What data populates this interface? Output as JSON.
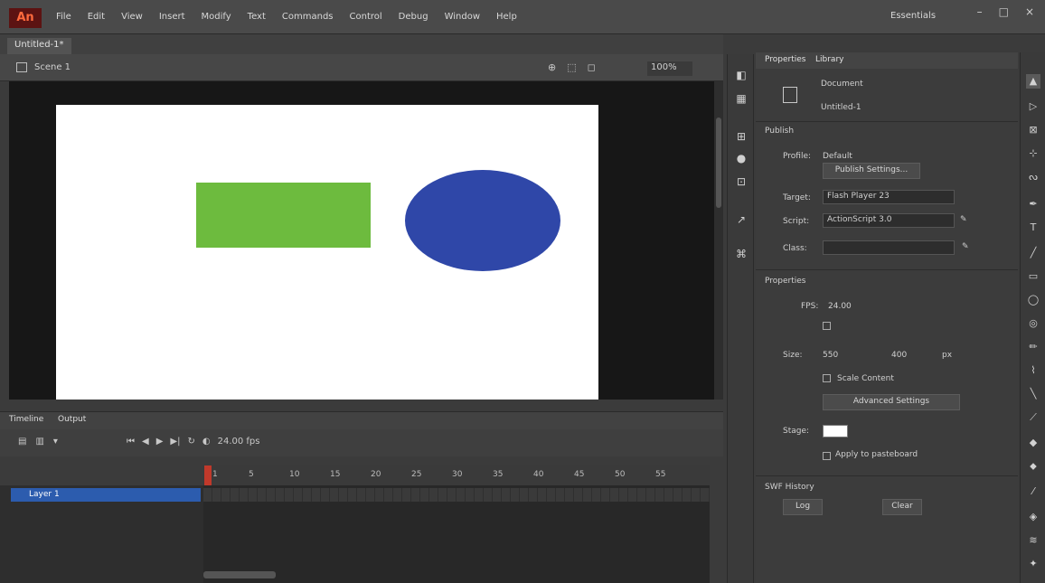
{
  "app": {
    "logo": "An"
  },
  "menu": [
    "File",
    "Edit",
    "View",
    "Insert",
    "Modify",
    "Text",
    "Commands",
    "Control",
    "Debug",
    "Window",
    "Help"
  ],
  "workspace": "Essentials",
  "window_controls": [
    "–",
    "□",
    "×"
  ],
  "document": {
    "tab": "Untitled-1*",
    "scene": "Scene 1",
    "zoom": "100%"
  },
  "stage": {
    "background": "#ffffff",
    "shapes": [
      {
        "kind": "rectangle",
        "fill": "#6dbb3e"
      },
      {
        "kind": "ellipse",
        "fill": "#2f47a8"
      }
    ]
  },
  "timeline": {
    "tabs": [
      "Timeline",
      "Output"
    ],
    "frame_numbers": [
      "1",
      "5",
      "10",
      "15",
      "20",
      "25",
      "30",
      "35",
      "40",
      "45",
      "50",
      "55"
    ],
    "layer": "Layer 1",
    "fps": "24.00 fps"
  },
  "properties": {
    "tabs": [
      "Properties",
      "Library"
    ],
    "doc_type": "Document",
    "doc_name": "Untitled-1",
    "publish_section": "Publish",
    "profile_label": "Profile:",
    "profile_value": "Default",
    "publish_settings": "Publish Settings...",
    "target_label": "Target:",
    "target_value": "Flash Player 23",
    "script_label": "Script:",
    "script_value": "ActionScript 3.0",
    "class_label": "Class:",
    "properties_section": "Properties",
    "fps_label": "FPS:",
    "fps_value": "24.00",
    "size_label": "Size:",
    "size_w": "550",
    "size_h": "400",
    "unit": "px",
    "scale_content": "Scale Content",
    "advanced_settings": "Advanced Settings",
    "stage_label": "Stage:",
    "apply_pasteboard": "Apply to pasteboard",
    "swf_section": "SWF History",
    "log_btn": "Log",
    "clear_btn": "Clear"
  },
  "colors": {
    "menubar": "#4a4a4a",
    "panel": "#3c3c3c",
    "pasteboard": "#171717",
    "selected_layer": "#2c5cae",
    "playhead": "#c0392b"
  }
}
